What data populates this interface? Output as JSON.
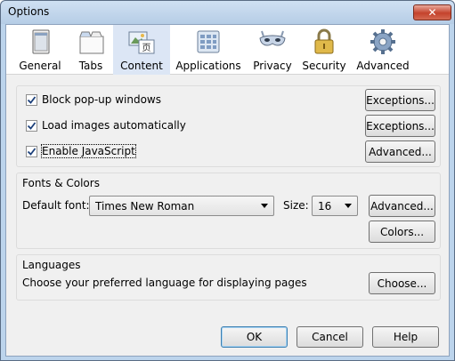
{
  "window": {
    "title": "Options",
    "close_glyph": "✕"
  },
  "toolbar": {
    "tabs": [
      {
        "label": "General",
        "icon": "general-window-icon"
      },
      {
        "label": "Tabs",
        "icon": "tabs-icon"
      },
      {
        "label": "Content",
        "icon": "content-icon",
        "selected": true
      },
      {
        "label": "Applications",
        "icon": "applications-icon"
      },
      {
        "label": "Privacy",
        "icon": "mask-icon"
      },
      {
        "label": "Security",
        "icon": "padlock-icon"
      },
      {
        "label": "Advanced",
        "icon": "gear-icon"
      }
    ]
  },
  "content": {
    "block_popups": {
      "label": "Block pop-up windows",
      "checked": true,
      "button": "Exceptions..."
    },
    "load_images": {
      "label": "Load images automatically",
      "checked": true,
      "button": "Exceptions..."
    },
    "javascript": {
      "label": "Enable JavaScript",
      "checked": true,
      "button": "Advanced..."
    }
  },
  "fonts": {
    "title": "Fonts & Colors",
    "default_font_label": "Default font:",
    "default_font_value": "Times New Roman",
    "size_label": "Size:",
    "size_value": "16",
    "advanced_button": "Advanced...",
    "colors_button": "Colors..."
  },
  "languages": {
    "title": "Languages",
    "description": "Choose your preferred language for displaying pages",
    "choose_button": "Choose..."
  },
  "footer": {
    "ok": "OK",
    "cancel": "Cancel",
    "help": "Help"
  }
}
